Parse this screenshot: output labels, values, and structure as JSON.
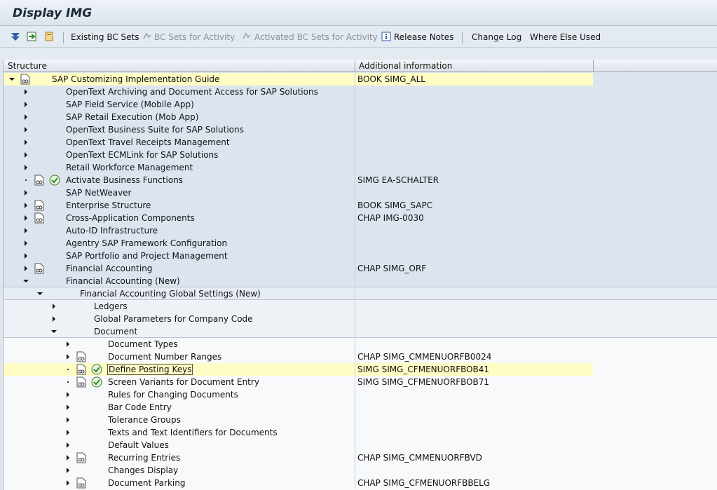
{
  "window": {
    "title": "Display IMG"
  },
  "toolbar": {
    "existing_bc_sets": "Existing BC Sets",
    "bc_sets_activity": "BC Sets for Activity",
    "activated_bc_sets": "Activated BC Sets for Activity",
    "release_notes": "Release Notes",
    "change_log": "Change Log",
    "where_else_used": "Where Else Used"
  },
  "columns": {
    "structure": "Structure",
    "additional": "Additional information"
  },
  "rows": [
    {
      "label": "SAP Customizing Implementation Guide",
      "info": "BOOK SIMG_ALL"
    },
    {
      "label": "OpenText Archiving and Document Access for SAP Solutions",
      "info": ""
    },
    {
      "label": "SAP Field Service (Mobile App)",
      "info": ""
    },
    {
      "label": "SAP Retail Execution (Mob App)",
      "info": ""
    },
    {
      "label": "OpenText Business Suite for SAP Solutions",
      "info": ""
    },
    {
      "label": "OpenText Travel Receipts Management",
      "info": ""
    },
    {
      "label": "OpenText ECMLink for SAP Solutions",
      "info": ""
    },
    {
      "label": "Retail Workforce Management",
      "info": ""
    },
    {
      "label": "Activate Business Functions",
      "info": "SIMG EA-SCHALTER"
    },
    {
      "label": "SAP NetWeaver",
      "info": ""
    },
    {
      "label": "Enterprise Structure",
      "info": "BOOK SIMG_SAPC"
    },
    {
      "label": "Cross-Application Components",
      "info": "CHAP IMG-0030"
    },
    {
      "label": "Auto-ID Infrastructure",
      "info": ""
    },
    {
      "label": "Agentry SAP Framework Configuration",
      "info": ""
    },
    {
      "label": "SAP Portfolio and Project Management",
      "info": ""
    },
    {
      "label": "Financial Accounting",
      "info": "CHAP SIMG_ORF"
    },
    {
      "label": "Financial Accounting (New)",
      "info": ""
    },
    {
      "label": "Financial Accounting Global Settings (New)",
      "info": ""
    },
    {
      "label": "Ledgers",
      "info": ""
    },
    {
      "label": "Global Parameters for Company Code",
      "info": ""
    },
    {
      "label": "Document",
      "info": ""
    },
    {
      "label": "Document Types",
      "info": ""
    },
    {
      "label": "Document Number Ranges",
      "info": "CHAP SIMG_CMMENUORFB0024"
    },
    {
      "label": "Define Posting Keys",
      "info": "SIMG SIMG_CFMENUORFBOB41"
    },
    {
      "label": "Screen Variants for Document Entry",
      "info": "SIMG SIMG_CFMENUORFBOB71"
    },
    {
      "label": "Rules for Changing Documents",
      "info": ""
    },
    {
      "label": "Bar Code Entry",
      "info": ""
    },
    {
      "label": "Tolerance Groups",
      "info": ""
    },
    {
      "label": "Texts and Text Identifiers for Documents",
      "info": ""
    },
    {
      "label": "Default Values",
      "info": ""
    },
    {
      "label": "Recurring Entries",
      "info": "CHAP SIMG_CMMENUORFBVD"
    },
    {
      "label": "Changes Display",
      "info": ""
    },
    {
      "label": "Document Parking",
      "info": "CHAP SIMG_CFMENUORFBBELG"
    }
  ]
}
